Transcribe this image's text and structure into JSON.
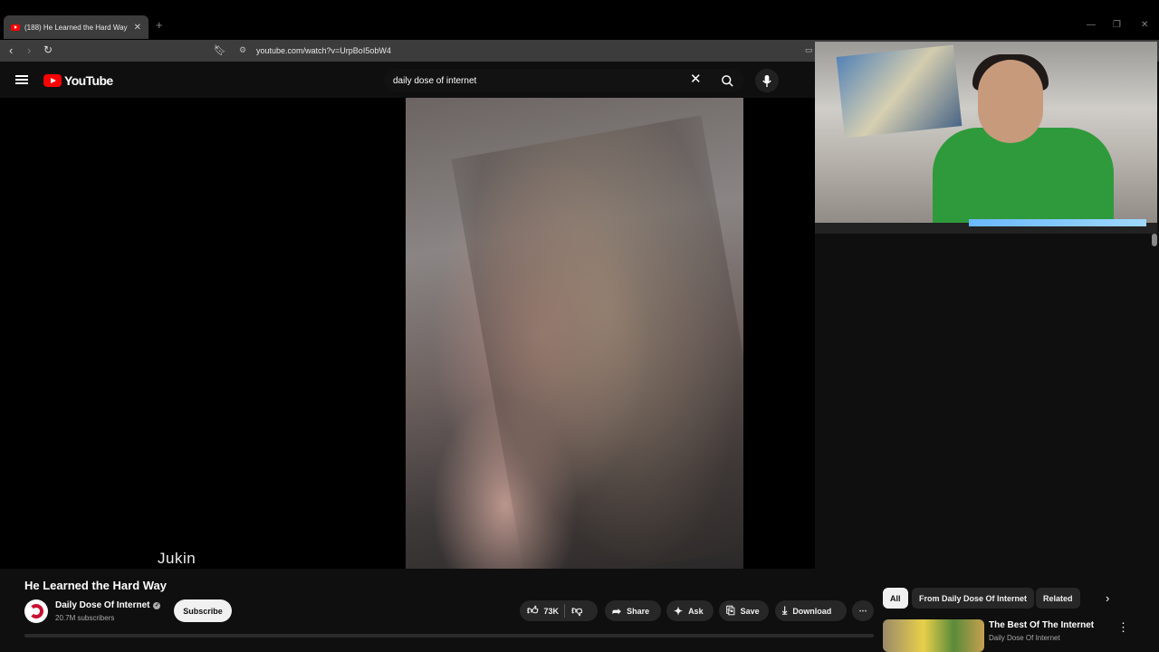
{
  "browser": {
    "tab_title": "(188) He Learned the Hard Way",
    "url": "youtube.com/watch?v=UrpBoI5obW4"
  },
  "youtube": {
    "logo_text": "YouTube",
    "search_value": "daily dose of internet"
  },
  "video": {
    "watermark": "Jukin",
    "title": "He Learned the Hard Way"
  },
  "channel": {
    "name": "Daily Dose Of Internet",
    "subscribers": "20.7M subscribers",
    "subscribe_label": "Subscribe"
  },
  "actions": {
    "likes": "73K",
    "share": "Share",
    "ask": "Ask",
    "save": "Save",
    "download": "Download"
  },
  "chips": [
    "All",
    "From Daily Dose Of Internet",
    "Related"
  ],
  "related": {
    "title": "The Best Of The Internet",
    "channel": "Daily Dose Of Internet"
  },
  "colors": {
    "brand_red": "#ff0000",
    "background": "#0f0f0f",
    "shirt_green": "#2f9a3c"
  }
}
